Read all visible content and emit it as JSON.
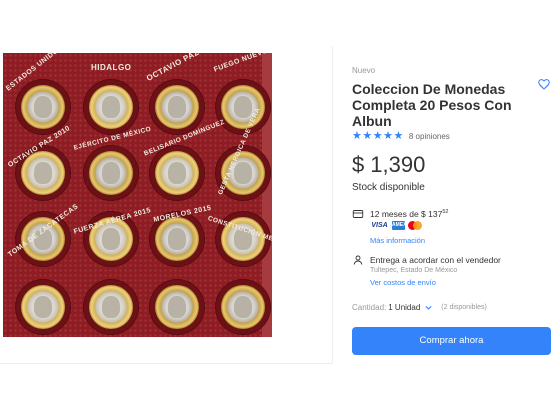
{
  "product": {
    "condition": "Nuevo",
    "title": "Coleccion De Monedas Completa 20 Pesos Con Albun",
    "rating_stars": 5,
    "opinions": "8 opiniones",
    "price_symbol": "$",
    "price": "1,390",
    "stock": "Stock disponible"
  },
  "installments": {
    "text": "12 meses de $ 137",
    "cents": "52",
    "cards": [
      "VISA",
      "AMEX",
      "mastercard"
    ],
    "more_info": "Más información"
  },
  "delivery": {
    "text": "Entrega a acordar con el vendedor",
    "location": "Tultepec, Estado De México",
    "shipping_link": "Ver costos de envío"
  },
  "quantity": {
    "label": "Cantidad:",
    "value": "1 Unidad",
    "available": "(2 disponibles)"
  },
  "buy_button": "Comprar ahora",
  "photo_labels": {
    "l1": "ESTADOS UNIDOS MEXICANOS",
    "l2": "HIDALGO",
    "l3": "OCTAVIO PAZ 2000",
    "l4": "FUEGO NUEVO 20",
    "l5": "OCTAVIO PAZ 2010",
    "l6": "EJÉRCITO DE MÉXICO",
    "l7": "BELISARIO DOMÍNGUEZ",
    "l8": "GESTA HEROICA DE VERA",
    "l9": "TOMA DE ZACATECAS",
    "l10": "FUERZA AÉREA 2015",
    "l11": "MORELOS 2015",
    "l12": "CONSTITUCIÓN MEX"
  },
  "colors": {
    "accent": "#3483fa",
    "album_red": "#8e1c22"
  },
  "icons": {
    "favorite": "heart-outline-icon",
    "installments": "credit-card-icon",
    "delivery": "person-pin-icon",
    "quantity": "chevron-down-icon"
  }
}
